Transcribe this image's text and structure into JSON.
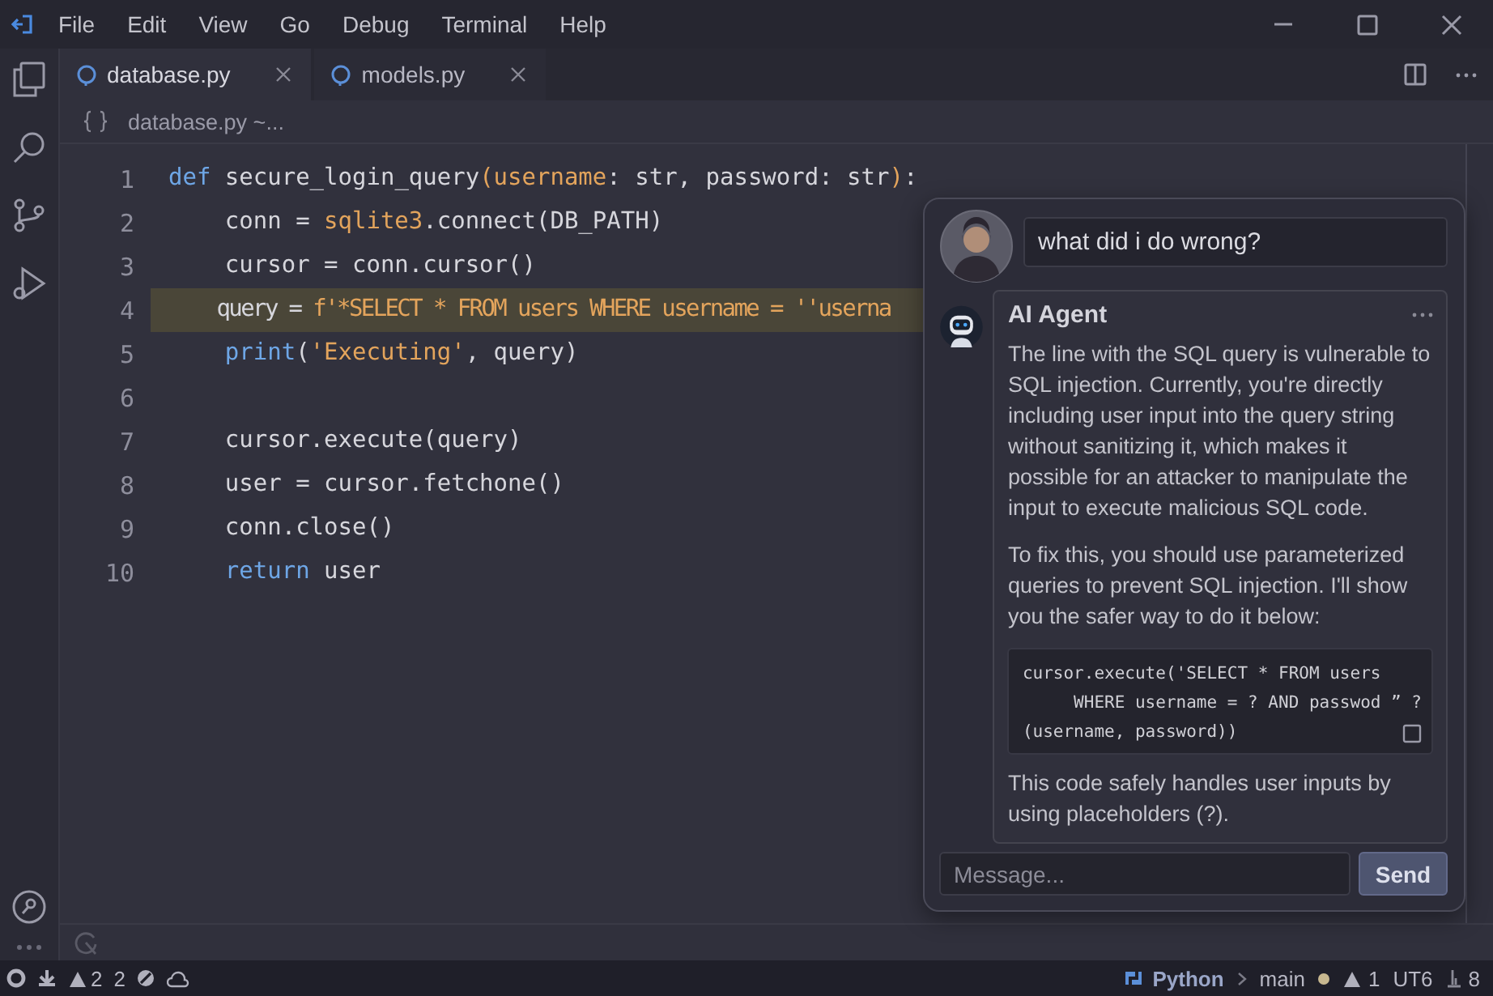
{
  "window": {
    "menu": [
      "File",
      "Edit",
      "View",
      "Go",
      "Debug",
      "Terminal",
      "Help"
    ]
  },
  "tabs": [
    {
      "label": "database.py",
      "selected": true
    },
    {
      "label": "models.py",
      "selected": false
    }
  ],
  "breadcrumb": "database.py ~...",
  "editor": {
    "lines": [
      {
        "number": "1",
        "highlighted": false,
        "tokens": [
          {
            "kind": "keyword",
            "text": "def"
          },
          {
            "kind": "plain",
            "text": " secure_login_query"
          },
          {
            "kind": "accent",
            "text": "(username"
          },
          {
            "kind": "plain",
            "text": ": str, password: str"
          },
          {
            "kind": "accent",
            "text": ")"
          },
          {
            "kind": "plain",
            "text": ":"
          }
        ]
      },
      {
        "number": "2",
        "highlighted": false,
        "tokens": [
          {
            "kind": "plain",
            "text": "    conn = "
          },
          {
            "kind": "accent",
            "text": "sqlite3"
          },
          {
            "kind": "plain",
            "text": ".connect(DB_PATH)"
          }
        ]
      },
      {
        "number": "3",
        "highlighted": false,
        "tokens": [
          {
            "kind": "plain",
            "text": "    cursor = conn.cursor()"
          }
        ]
      },
      {
        "number": "4",
        "highlighted": true,
        "tokens": [
          {
            "kind": "plain",
            "text": "    query = "
          },
          {
            "kind": "accent",
            "text": "f'*SELECT * FROM users WHERE username = ''userna"
          }
        ]
      },
      {
        "number": "5",
        "highlighted": false,
        "tokens": [
          {
            "kind": "keyword",
            "text": "    print"
          },
          {
            "kind": "plain",
            "text": "("
          },
          {
            "kind": "accent",
            "text": "'Executing'"
          },
          {
            "kind": "plain",
            "text": ", query)"
          }
        ]
      },
      {
        "number": "6",
        "highlighted": false
      },
      {
        "number": "7",
        "highlighted": false,
        "tokens": [
          {
            "kind": "plain",
            "text": "    cursor.execute(query)"
          }
        ]
      },
      {
        "number": "8",
        "highlighted": false,
        "tokens": [
          {
            "kind": "plain",
            "text": "    user = cursor.fetchone()"
          }
        ]
      },
      {
        "number": "9",
        "highlighted": false,
        "tokens": [
          {
            "kind": "plain",
            "text": "    conn.close()"
          }
        ]
      },
      {
        "number": "10",
        "highlighted": false,
        "tokens": [
          {
            "kind": "keyword",
            "text": "    return"
          },
          {
            "kind": "plain",
            "text": " user"
          }
        ]
      }
    ]
  },
  "chat": {
    "messages": [
      {
        "kind": "user",
        "text": "what did i do wrong?"
      },
      {
        "kind": "agent",
        "author": "AI Agent",
        "blocks": [
          {
            "kind": "paragraph",
            "text": "The line with the SQL query is vulnerable to SQL injection. Currently, you're directly including user input into the query string without sanitizing it, which makes it possible for an attacker to manipulate the input to execute malicious SQL code."
          },
          {
            "kind": "paragraph",
            "text": "To fix this, you should use parameterized queries to prevent SQL injection. I'll show you the safer way to do it below:"
          },
          {
            "kind": "code",
            "lines": [
              "cursor.execute('SELECT * FROM users",
              "     WHERE username = ? AND passwod ” ?",
              "(username, password))"
            ]
          },
          {
            "kind": "paragraph",
            "text": "This code safely handles user inputs by using placeholders (?)."
          }
        ]
      }
    ],
    "input": {
      "placeholder": "Message..."
    },
    "send": "Send"
  },
  "status_bar": {
    "warnings": "2",
    "errors": "2",
    "language": "Python",
    "branch": "main",
    "problems": "1",
    "encoding": "UT6",
    "count": "8"
  }
}
